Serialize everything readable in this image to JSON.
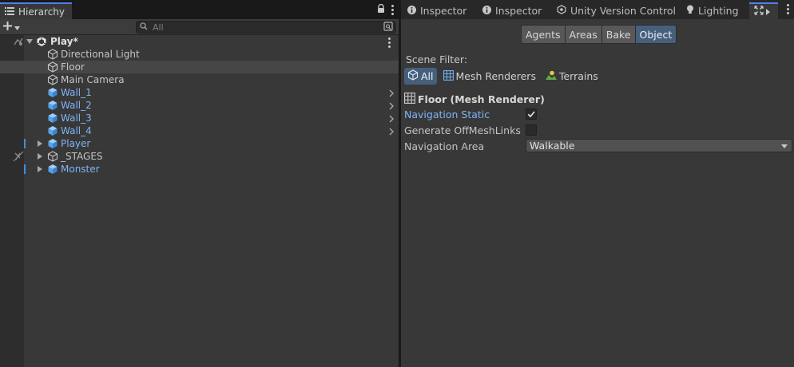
{
  "hierarchy": {
    "tab_label": "Hierarchy",
    "search_placeholder": "All",
    "root": "Play*",
    "items": [
      {
        "name": "Directional Light",
        "color": "normal"
      },
      {
        "name": "Floor",
        "color": "normal",
        "selected": true
      },
      {
        "name": "Main Camera",
        "color": "normal"
      },
      {
        "name": "Wall_1",
        "color": "blue"
      },
      {
        "name": "Wall_2",
        "color": "blue"
      },
      {
        "name": "Wall_3",
        "color": "blue"
      },
      {
        "name": "Wall_4",
        "color": "blue"
      },
      {
        "name": "Player",
        "color": "blue"
      },
      {
        "name": "_STAGES",
        "color": "normal"
      },
      {
        "name": "Monster",
        "color": "blue"
      }
    ]
  },
  "tabs": [
    {
      "label": "Inspector",
      "icon": "info-icon"
    },
    {
      "label": "Inspector",
      "icon": "info-icon"
    },
    {
      "label": "Unity Version Control",
      "icon": "version-control-icon"
    },
    {
      "label": "Lighting",
      "icon": "lightbulb-icon"
    }
  ],
  "navigation": {
    "segments": [
      "Agents",
      "Areas",
      "Bake",
      "Object"
    ],
    "active_segment": "Object",
    "scene_filter_label": "Scene Filter:",
    "filters": [
      "All",
      "Mesh Renderers",
      "Terrains"
    ],
    "component_header": "Floor (Mesh Renderer)",
    "navigation_static_label": "Navigation Static",
    "navigation_static_checked": true,
    "generate_offmeshlinks_label": "Generate OffMeshLinks",
    "generate_offmeshlinks_checked": false,
    "navigation_area_label": "Navigation Area",
    "navigation_area_value": "Walkable"
  },
  "colors": {
    "accent_blue": "#4f80f8",
    "prefab_blue": "#7fb4f6",
    "active_toggle": "#46607c"
  }
}
